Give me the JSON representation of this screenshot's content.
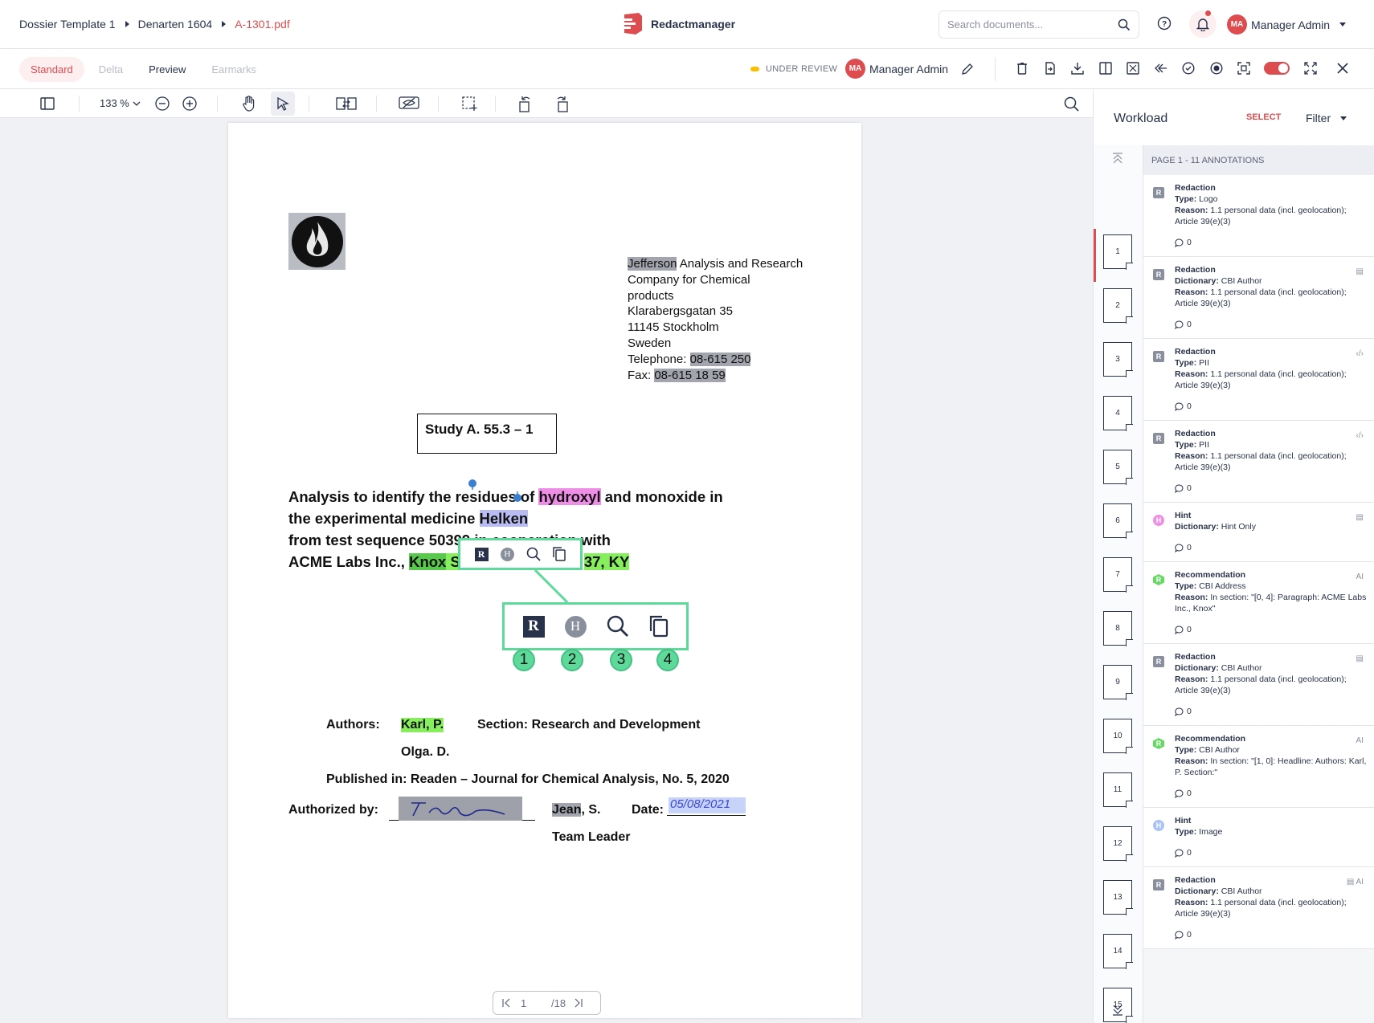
{
  "breadcrumb": [
    "Dossier Template 1",
    "Denarten 1604",
    "A-1301.pdf"
  ],
  "brand": "Redactmanager",
  "search": {
    "placeholder": "Search documents..."
  },
  "user": {
    "initials": "MA",
    "name": "Manager Admin"
  },
  "view_tabs": [
    {
      "label": "Standard",
      "state": "active"
    },
    {
      "label": "Delta",
      "state": "disabled"
    },
    {
      "label": "Preview",
      "state": "normal"
    },
    {
      "label": "Earmarks",
      "state": "disabled"
    }
  ],
  "file_status": "UNDER REVIEW",
  "assignee": {
    "initials": "MA",
    "name": "Manager Admin"
  },
  "toolbar": {
    "zoom": "133 %"
  },
  "document": {
    "address_first_word": "Jefferson",
    "address_rest_line1": " Analysis and Research",
    "address_lines": [
      "Company for Chemical",
      "products",
      "Klarabergsgatan 35",
      "11145 Stockholm",
      "Sweden"
    ],
    "telephone_label": "Telephone: ",
    "telephone": "08-615 250",
    "fax_label": "Fax: ",
    "fax": "08-615 18 59",
    "study": "Study A. 55.3 – 1",
    "title_1a": "Analysis to identify the residues of ",
    "title_1b": "hydroxyl",
    "title_1c": " and monoxide in",
    "title_2a": "the experimental medicine ",
    "title_2b": "Helken",
    "title_3": "from test sequence 50399 in cooperation with",
    "title_4a": "ACME Labs Inc., ",
    "title_4b": "Knox",
    "title_4c": " S",
    "title_4d": "37, KY",
    "callouts": [
      "1",
      "2",
      "3",
      "4"
    ],
    "authors_label": "Authors:",
    "author_1": "Karl, P.",
    "author_2": "Olga. D.",
    "section": "Section: Research and Development",
    "published": "Published in: Readen – Journal for Chemical Analysis, No. 5, 2020",
    "authorized_label": "Authorized by:",
    "signer_first": "Jean",
    "signer_rest": ", S.",
    "signer_role": "Team Leader",
    "date_label": "Date:",
    "date_value": "05/08/2021"
  },
  "pager": {
    "current": "1",
    "total": "/18"
  },
  "workload": {
    "title": "Workload",
    "select_label": "SELECT",
    "filter_label": "Filter",
    "page_header": "PAGE 1 - 11 ANNOTATIONS",
    "thumbnails": [
      "1",
      "2",
      "3",
      "4",
      "5",
      "6",
      "7",
      "8",
      "9",
      "10",
      "11",
      "12",
      "13",
      "14",
      "15"
    ],
    "annotations": [
      {
        "badge": "R",
        "kind": "r",
        "title": "Redaction",
        "k1": "Type:",
        "v1": "Logo",
        "k2": "Reason:",
        "v2": "1.1 personal data (incl. geolocation); Article 39(e)(3)",
        "comments": "0",
        "flag": ""
      },
      {
        "badge": "R",
        "kind": "r",
        "title": "Redaction",
        "k1": "Dictionary:",
        "v1": "CBI Author",
        "k2": "Reason:",
        "v2": "1.1 personal data (incl. geolocation); Article 39(e)(3)",
        "comments": "0",
        "flag": "▤"
      },
      {
        "badge": "R",
        "kind": "r",
        "title": "Redaction",
        "k1": "Type:",
        "v1": "PII",
        "k2": "Reason:",
        "v2": "1.1 personal data (incl. geolocation); Article 39(e)(3)",
        "comments": "0",
        "flag": "‹/›"
      },
      {
        "badge": "R",
        "kind": "r",
        "title": "Redaction",
        "k1": "Type:",
        "v1": "PII",
        "k2": "Reason:",
        "v2": "1.1 personal data (incl. geolocation); Article 39(e)(3)",
        "comments": "0",
        "flag": "‹/›"
      },
      {
        "badge": "H",
        "kind": "h",
        "title": "Hint",
        "k1": "Dictionary:",
        "v1": "Hint Only",
        "k2": "",
        "v2": "",
        "comments": "0",
        "flag": "▤"
      },
      {
        "badge": "R",
        "kind": "g",
        "title": "Recommendation",
        "k1": "Type:",
        "v1": "CBI Address",
        "k2": "Reason:",
        "v2": "In section: \"[0, 4]: Paragraph: ACME Labs Inc., Knox\"",
        "comments": "0",
        "flag": "AI"
      },
      {
        "badge": "R",
        "kind": "r",
        "title": "Redaction",
        "k1": "Dictionary:",
        "v1": "CBI Author",
        "k2": "Reason:",
        "v2": "1.1 personal data (incl. geolocation); Article 39(e)(3)",
        "comments": "0",
        "flag": "▤"
      },
      {
        "badge": "R",
        "kind": "g",
        "title": "Recommendation",
        "k1": "Type:",
        "v1": "CBI Author",
        "k2": "Reason:",
        "v2": "In section: \"[1, 0]: Headline: Authors: Karl, P. Section:\"",
        "comments": "0",
        "flag": "AI"
      },
      {
        "badge": "H",
        "kind": "hb",
        "title": "Hint",
        "k1": "Type:",
        "v1": "Image",
        "k2": "",
        "v2": "",
        "comments": "0",
        "flag": ""
      },
      {
        "badge": "R",
        "kind": "r",
        "title": "Redaction",
        "k1": "Dictionary:",
        "v1": "CBI Author",
        "k2": "Reason:",
        "v2": "1.1 personal data (incl. geolocation); Article 39(e)(3)",
        "comments": "0",
        "flag": "▤ AI"
      }
    ]
  },
  "colors": {
    "accent": "#dd4d50",
    "highlight_green": "#5dd99a",
    "status_yellow": "#fdbd00"
  }
}
